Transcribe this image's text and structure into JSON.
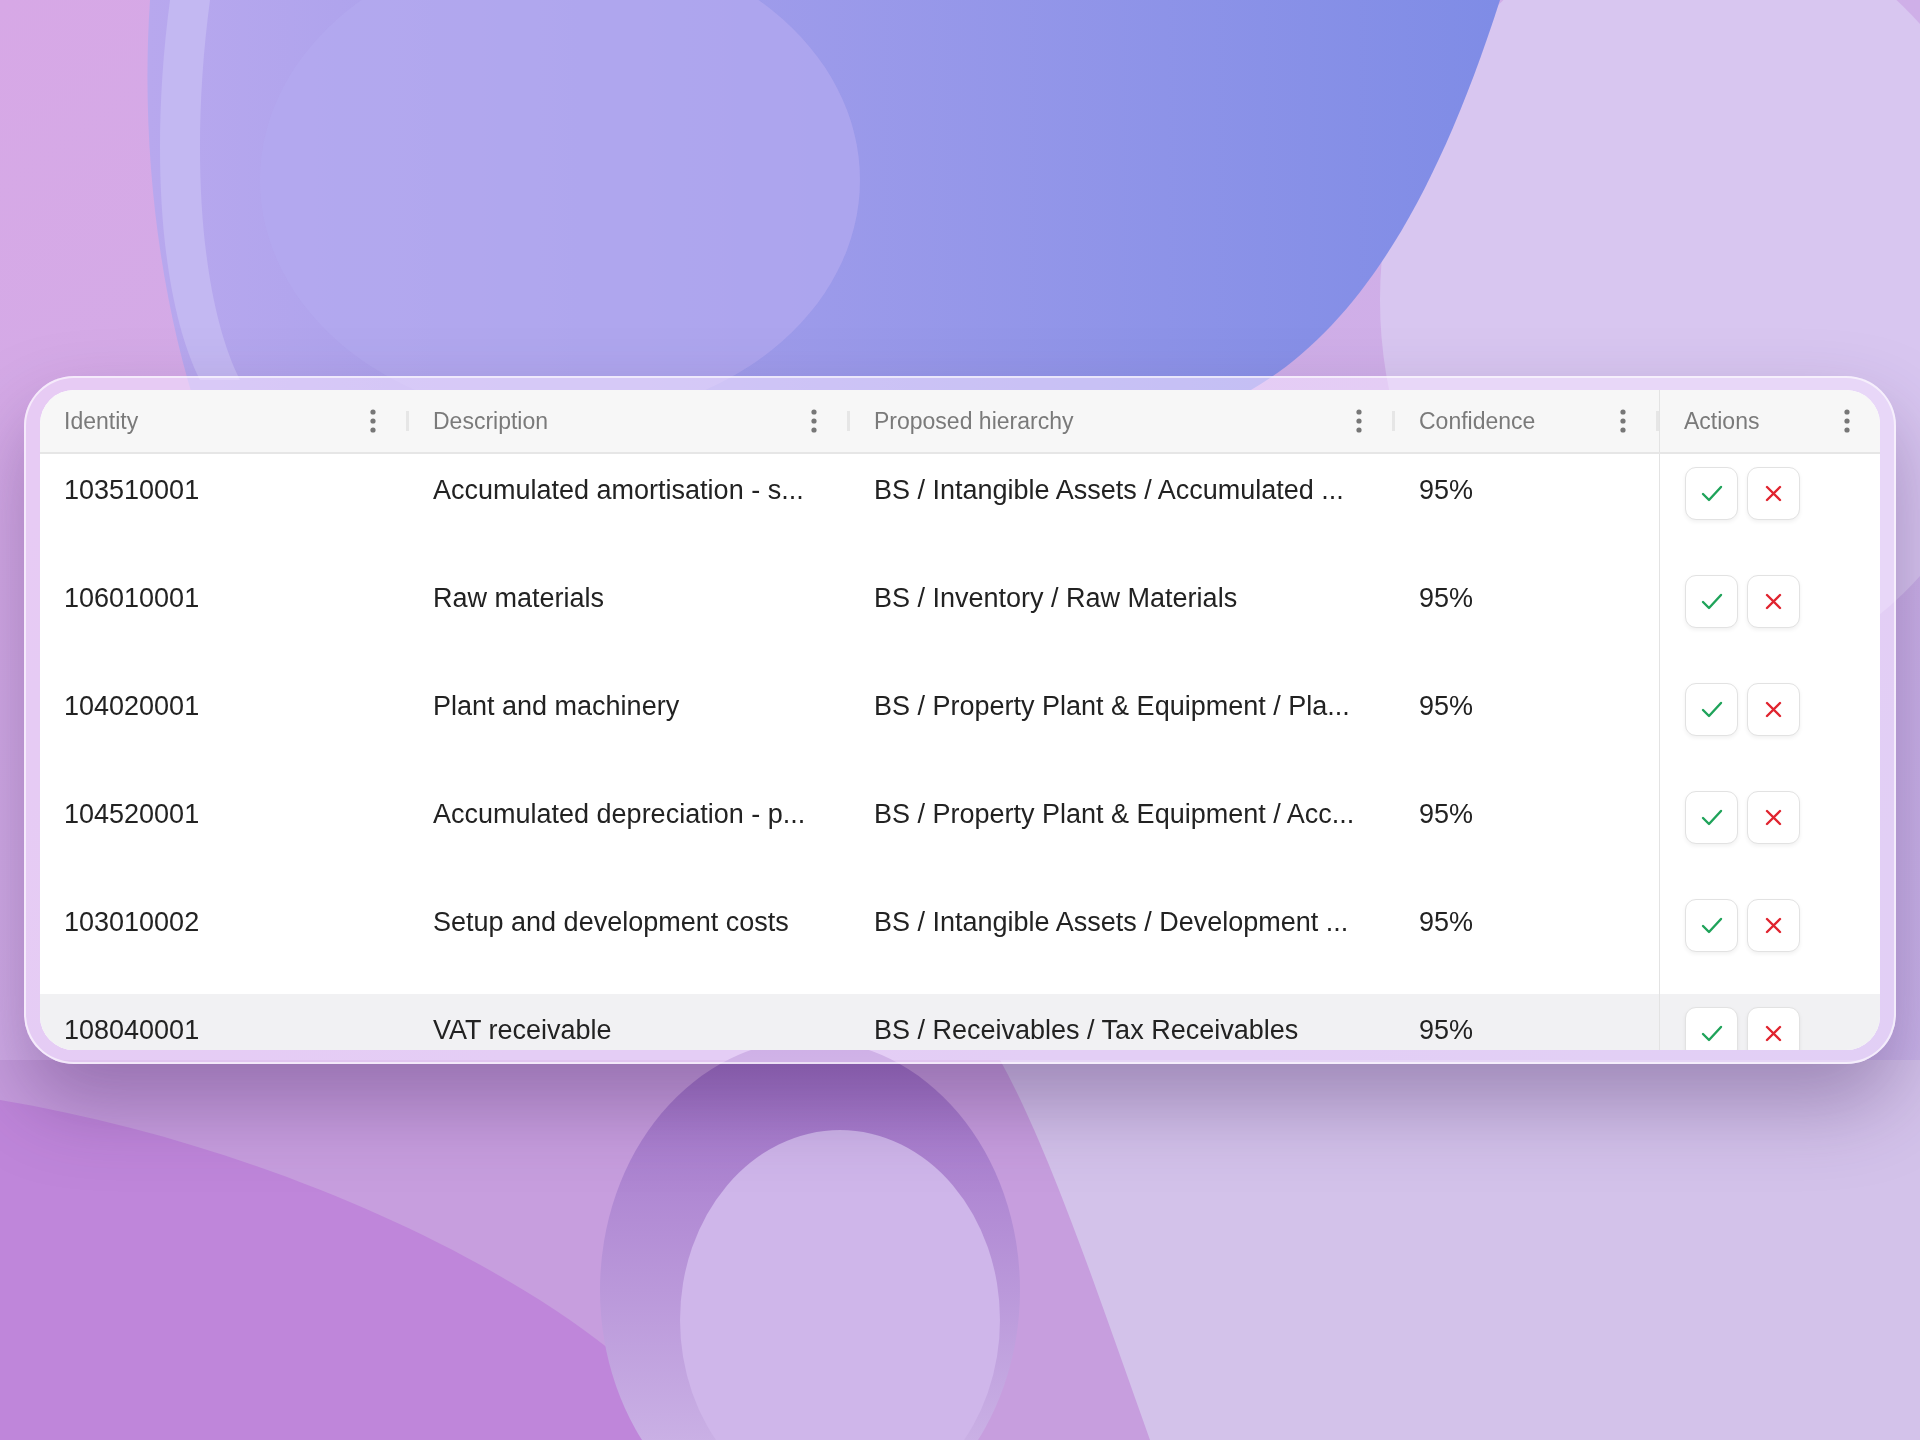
{
  "table": {
    "columns": [
      {
        "label": "Identity"
      },
      {
        "label": "Description"
      },
      {
        "label": "Proposed hierarchy"
      },
      {
        "label": "Confidence"
      },
      {
        "label": "Actions"
      }
    ],
    "rows": [
      {
        "identity": "103510001",
        "description": "Accumulated amortisation - s...",
        "hierarchy": "BS / Intangible Assets / Accumulated ...",
        "confidence": "95%",
        "highlighted": false
      },
      {
        "identity": "106010001",
        "description": "Raw materials",
        "hierarchy": "BS / Inventory / Raw Materials",
        "confidence": "95%",
        "highlighted": false
      },
      {
        "identity": "104020001",
        "description": "Plant and machinery",
        "hierarchy": "BS / Property Plant & Equipment / Pla...",
        "confidence": "95%",
        "highlighted": false
      },
      {
        "identity": "104520001",
        "description": "Accumulated depreciation - p...",
        "hierarchy": "BS / Property Plant & Equipment / Acc...",
        "confidence": "95%",
        "highlighted": false
      },
      {
        "identity": "103010002",
        "description": "Setup and development costs",
        "hierarchy": "BS / Intangible Assets / Development ...",
        "confidence": "95%",
        "highlighted": false
      },
      {
        "identity": "108040001",
        "description": "VAT receivable",
        "hierarchy": "BS / Receivables / Tax Receivables",
        "confidence": "95%",
        "highlighted": true
      }
    ]
  }
}
